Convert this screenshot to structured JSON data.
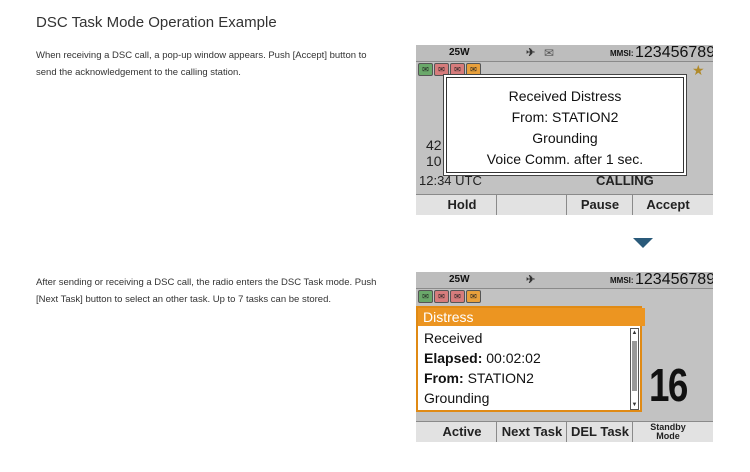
{
  "page": {
    "title": "DSC Task Mode Operation Example"
  },
  "section1": {
    "description": "When receiving a DSC call, a pop-up window appears. Push [Accept] button to send the acknowledgement to the calling station.",
    "screen": {
      "power": "25W",
      "mmsi_label": "MMSI:",
      "mmsi_value": "123456789",
      "bg_channel_top": "42",
      "bg_channel_bottom": "10",
      "bg_time": "12:34 UTC",
      "bg_status": "CALLING",
      "popup": {
        "line1": "Received Distress",
        "line2": "From: STATION2",
        "line3": "Grounding",
        "line4": "Voice Comm. after 1 sec."
      },
      "softkeys": [
        "Hold",
        "",
        "Pause",
        "Accept"
      ]
    }
  },
  "section2": {
    "description": "After sending or receiving a DSC call, the radio enters the DSC Task mode. Push [Next Task] button to select an other task. Up to 7 tasks can be stored.",
    "screen": {
      "power": "25W",
      "mmsi_label": "MMSI:",
      "mmsi_value": "123456789",
      "task": {
        "header": "Distress",
        "line1": "Received",
        "elapsed_label": "Elapsed:",
        "elapsed_value": "00:02:02",
        "from_label": "From:",
        "from_value": "STATION2",
        "line4": "Grounding"
      },
      "channel": "16",
      "softkeys": [
        "Active",
        "Next Task",
        "DEL Task"
      ],
      "softkey_last_line1": "Standby",
      "softkey_last_line2": "Mode"
    }
  },
  "colors": {
    "task_header": "#ec9521",
    "arrow": "#2a5a7a"
  }
}
